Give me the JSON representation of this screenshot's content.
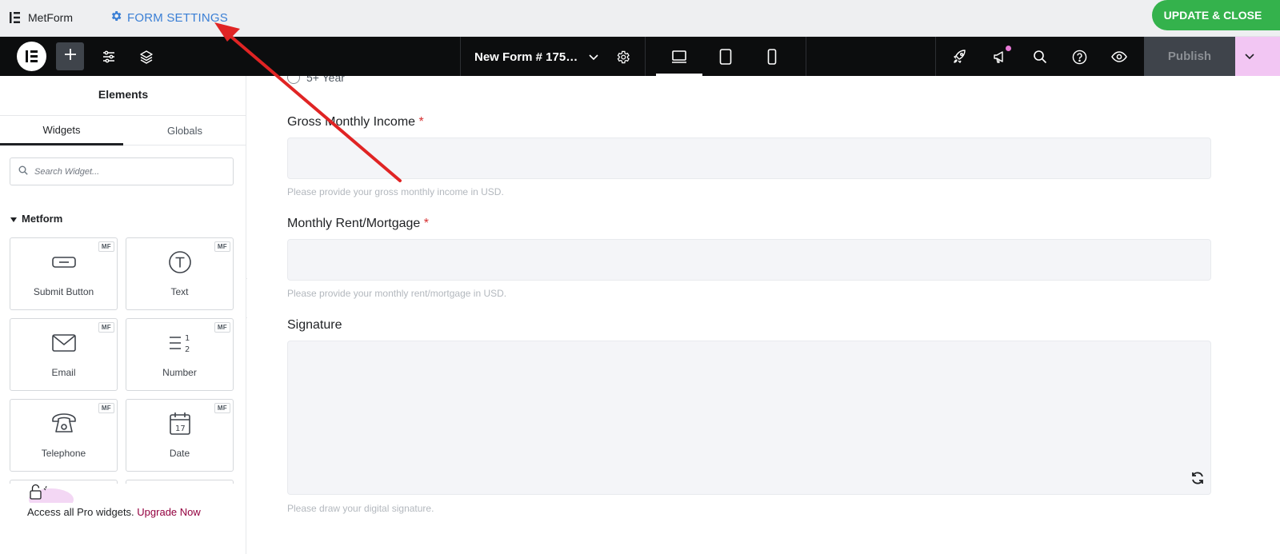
{
  "topbar": {
    "brand_name": "MetForm",
    "brand_icon": "elementor-bars-icon",
    "form_settings_label": "FORM SETTINGS",
    "form_settings_icon": "gear-icon",
    "update_close_label": "UPDATE & CLOSE",
    "accent_color": "#3a7fd5",
    "update_color": "#34b24c"
  },
  "editor_header": {
    "logo_icon": "elementor-logo-icon",
    "tools": [
      "add-element-icon",
      "site-settings-icon",
      "structure-layers-icon"
    ],
    "document_name": "New Form # 175…",
    "devices": [
      "desktop-icon",
      "tablet-icon",
      "mobile-icon"
    ],
    "active_device": "desktop",
    "right_tools": [
      "launchpad-rocket-icon",
      "notifications-megaphone-icon",
      "search-icon",
      "help-icon",
      "preview-eye-icon"
    ],
    "publish_label": "Publish"
  },
  "panel": {
    "title": "Elements",
    "tabs": [
      {
        "label": "Widgets",
        "active": true
      },
      {
        "label": "Globals",
        "active": false
      }
    ],
    "search_placeholder": "Search Widget...",
    "category": "Metform",
    "badge": "MF",
    "widgets": [
      {
        "label": "Submit Button",
        "icon": "submit-button-icon"
      },
      {
        "label": "Text",
        "icon": "text-icon"
      },
      {
        "label": "Email",
        "icon": "envelope-icon"
      },
      {
        "label": "Number",
        "icon": "number-list-icon"
      },
      {
        "label": "Telephone",
        "icon": "telephone-icon"
      },
      {
        "label": "Date",
        "icon": "calendar-icon"
      }
    ],
    "promo_text": "Access all Pro widgets.",
    "promo_link": "Upgrade Now"
  },
  "form": {
    "radio_option": "5+ Year",
    "fields": [
      {
        "label": "Gross Monthly Income",
        "required_mark": "*",
        "help": "Please provide your gross monthly income in USD.",
        "value": ""
      },
      {
        "label": "Monthly Rent/Mortgage",
        "required_mark": "*",
        "help": "Please provide your monthly rent/mortgage in USD.",
        "value": ""
      }
    ],
    "signature": {
      "label": "Signature",
      "help": "Please draw your digital signature.",
      "reset_icon": "refresh-icon"
    }
  },
  "annotation": {
    "arrow_color": "#e02424",
    "points_to": "form-settings-button"
  }
}
